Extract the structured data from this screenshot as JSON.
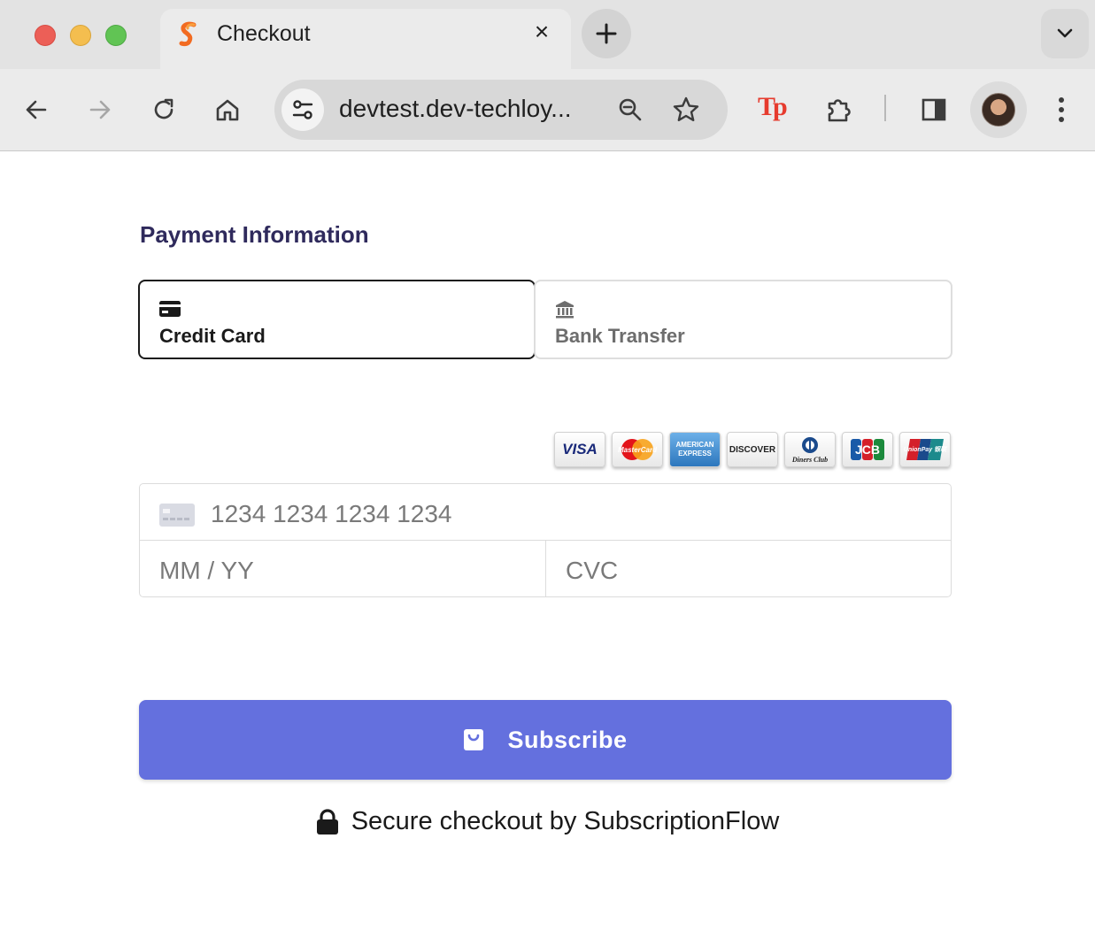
{
  "browser": {
    "tab_title": "Checkout",
    "url": "devtest.dev-techloy...",
    "extension_badge": "Tp"
  },
  "page": {
    "section_title": "Payment Information",
    "methods": [
      {
        "label": "Credit Card",
        "icon": "credit-card-icon",
        "selected": true
      },
      {
        "label": "Bank Transfer",
        "icon": "bank-icon",
        "selected": false
      }
    ],
    "card_brands": [
      {
        "name": "VISA"
      },
      {
        "name": "MasterCard"
      },
      {
        "name": "AMERICAN EXPRESS"
      },
      {
        "name": "DISCOVER"
      },
      {
        "name": "Diners Club"
      },
      {
        "name": "JCB"
      },
      {
        "name": "UnionPay 银联"
      }
    ],
    "card_number_placeholder": "1234 1234 1234 1234",
    "expiry_placeholder": "MM / YY",
    "cvc_placeholder": "CVC",
    "subscribe_label": "Subscribe",
    "secure_text": "Secure checkout by SubscriptionFlow"
  },
  "colors": {
    "accent": "#6470de",
    "title": "#2f2a5c"
  }
}
